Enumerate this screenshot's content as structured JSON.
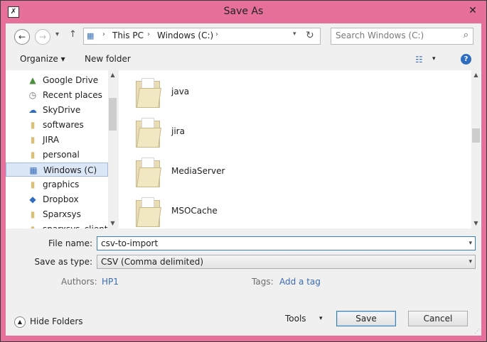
{
  "window": {
    "title": "Save As",
    "app_icon": "app-icon",
    "close_glyph": "✕"
  },
  "nav": {
    "back_glyph": "←",
    "forward_glyph": "→",
    "recent_glyph": "▾",
    "up_glyph": "↑",
    "breadcrumb": [
      "This PC",
      "Windows (C:)"
    ],
    "crumb_sep": "›",
    "search_placeholder": "Search Windows (C:)"
  },
  "toolbar": {
    "organize": "Organize",
    "new_folder": "New folder",
    "help_glyph": "?"
  },
  "sidebar": {
    "items": [
      {
        "label": "Google Drive",
        "icon": "google-drive-icon"
      },
      {
        "label": "Recent places",
        "icon": "recent-places-icon"
      },
      {
        "label": "SkyDrive",
        "icon": "skydrive-icon"
      },
      {
        "label": "softwares",
        "icon": "folder-icon"
      },
      {
        "label": "JIRA",
        "icon": "folder-icon"
      },
      {
        "label": "personal",
        "icon": "folder-icon"
      },
      {
        "label": "Windows (C)",
        "icon": "drive-icon",
        "selected": true
      },
      {
        "label": "graphics",
        "icon": "folder-icon"
      },
      {
        "label": "Dropbox",
        "icon": "dropbox-icon"
      },
      {
        "label": "Sparxsys",
        "icon": "folder-icon"
      },
      {
        "label": "sparxsys_clients",
        "icon": "folder-icon"
      }
    ]
  },
  "files": [
    {
      "name": "java"
    },
    {
      "name": "jira"
    },
    {
      "name": "MediaServer"
    },
    {
      "name": "MSOCache"
    }
  ],
  "form": {
    "file_name_label": "File name:",
    "file_name_value": "csv-to-import",
    "save_type_label": "Save as type:",
    "save_type_value": "CSV (Comma delimited)",
    "authors_label": "Authors:",
    "authors_value": "HP1",
    "tags_label": "Tags:",
    "tags_value": "Add a tag"
  },
  "footer": {
    "hide_folders": "Hide Folders",
    "tools": "Tools",
    "save": "Save",
    "cancel": "Cancel"
  },
  "colors": {
    "frame": "#e76f9b",
    "accent": "#2e6dbf",
    "link": "#3a6cb0"
  }
}
